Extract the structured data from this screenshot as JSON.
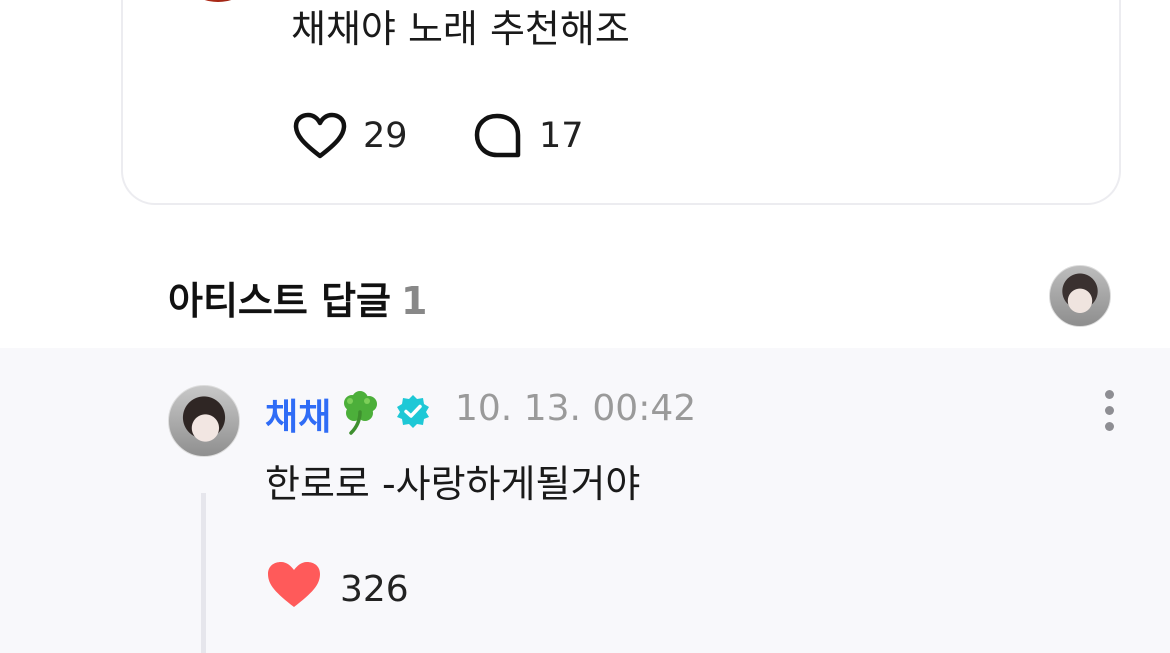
{
  "post": {
    "text": "채채야 노래 추천해조",
    "likes": "29",
    "comments": "17"
  },
  "artist_replies": {
    "title": "아티스트 답글",
    "count": "1"
  },
  "reply": {
    "author": "채채",
    "timestamp": "10. 13. 00:42",
    "text": "한로로 -사랑하게될거야",
    "likes": "326",
    "like_color": "#ff5a5a",
    "name_color": "#2f6cf6",
    "verified_color": "#1ec8d6"
  }
}
